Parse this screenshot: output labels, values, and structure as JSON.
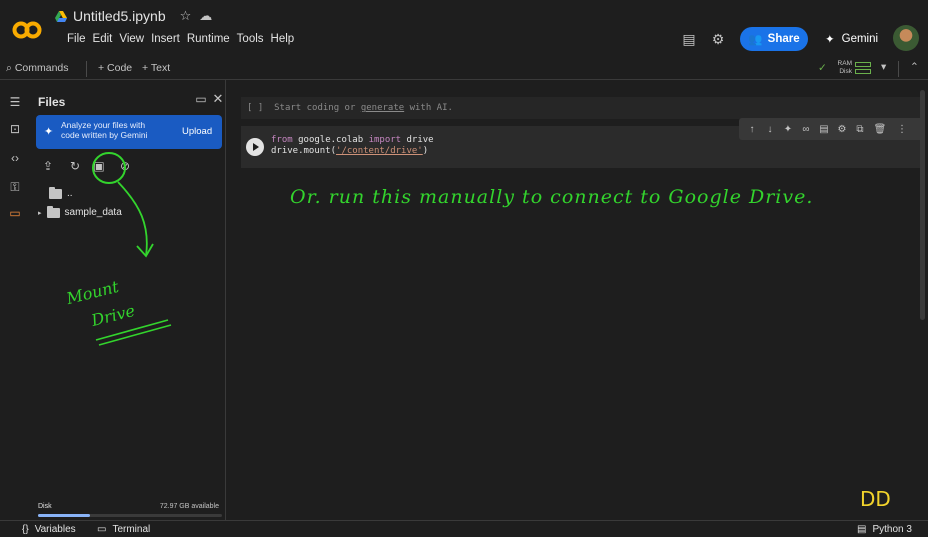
{
  "header": {
    "file_name": "Untitled5.ipynb",
    "menu": [
      "File",
      "Edit",
      "View",
      "Insert",
      "Runtime",
      "Tools",
      "Help"
    ],
    "share_label": "Share",
    "gemini_label": "Gemini"
  },
  "toolbar": {
    "commands_label": "Commands",
    "add_code_label": "+ Code",
    "add_text_label": "+ Text",
    "ram_label": "RAM",
    "disk_label": "Disk"
  },
  "files_panel": {
    "title": "Files",
    "banner_text": "Analyze your files with code written by Gemini",
    "upload_label": "Upload",
    "tree": [
      {
        "label": ".."
      },
      {
        "label": "sample_data"
      }
    ],
    "disk_label": "Disk",
    "disk_available": "72.97 GB available",
    "disk_used_fraction": 0.28
  },
  "cells": {
    "empty_cell_prefix": "[ ]",
    "empty_cell_text": "Start coding or",
    "empty_cell_link": "generate",
    "empty_cell_suffix": "with AI.",
    "code_line1_kw1": "from",
    "code_line1_mod": "google.colab",
    "code_line1_kw2": "import",
    "code_line1_name": "drive",
    "code_line2_call": "drive.mount(",
    "code_line2_str": "'/content/drive'",
    "code_line2_end": ")"
  },
  "statusbar": {
    "variables_label": "Variables",
    "terminal_label": "Terminal",
    "runtime_label": "Python 3"
  },
  "annotations": {
    "main_note": "Or. run this manually to connect to Google Drive.",
    "mount_line1": "Mount",
    "mount_line2": "Drive",
    "initials": "DD"
  },
  "colors": {
    "accent": "#1a73e8",
    "ink_green": "#33d42d",
    "ink_yellow": "#f2d32c"
  }
}
